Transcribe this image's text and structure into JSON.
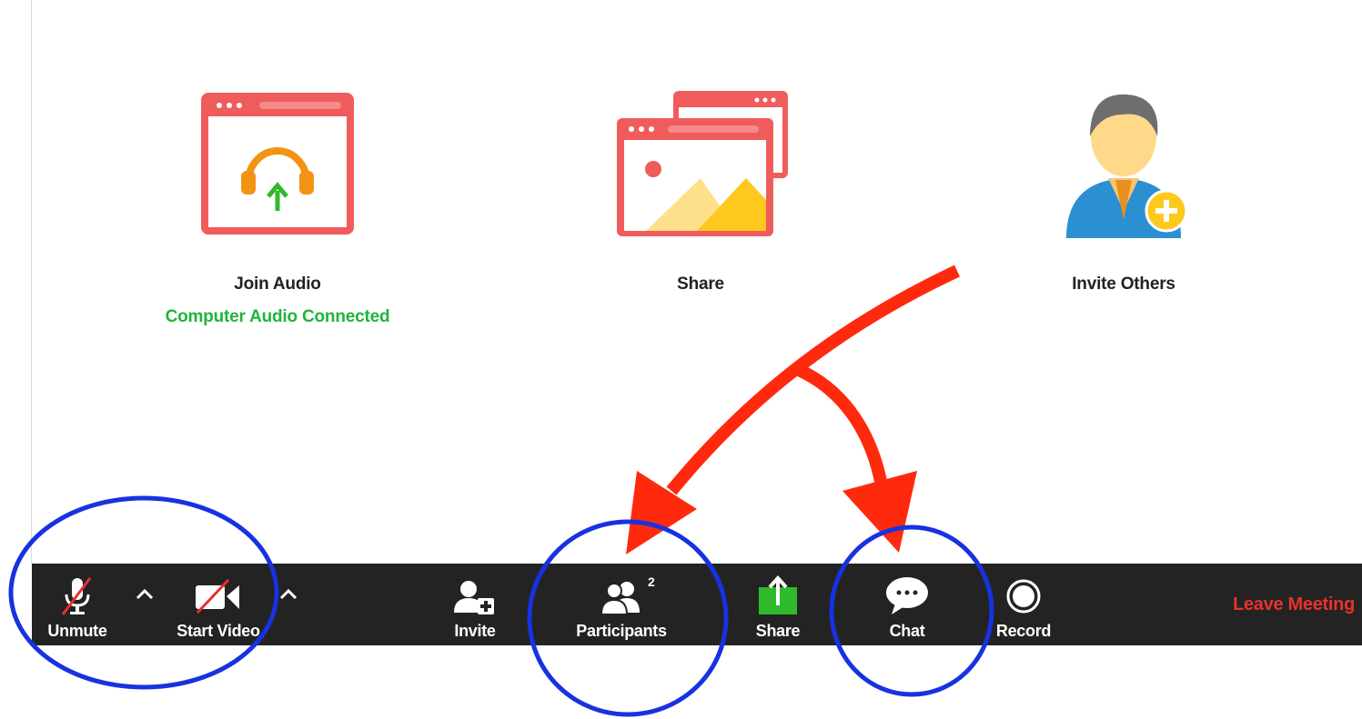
{
  "options": {
    "join_audio": {
      "label": "Join Audio",
      "status": "Computer Audio Connected"
    },
    "share": {
      "label": "Share"
    },
    "invite_others": {
      "label": "Invite Others"
    }
  },
  "toolbar": {
    "unmute": "Unmute",
    "start_video": "Start Video",
    "invite": "Invite",
    "participants": "Participants",
    "participants_count": "2",
    "share": "Share",
    "chat": "Chat",
    "record": "Record",
    "leave": "Leave Meeting"
  },
  "colors": {
    "accent_red": "#f05c5c",
    "status_green": "#1fb43b",
    "leave_red": "#e8312c",
    "annotation_blue": "#1732e0",
    "annotation_red": "#ff2a0e",
    "toolbar_bg": "#232323"
  },
  "icons": {
    "join_audio": "headphones-window-icon",
    "share": "picture-windows-icon",
    "invite_others": "person-add-icon",
    "unmute": "muted-microphone-icon",
    "start_video": "video-off-icon",
    "invite": "person-plus-icon",
    "participants": "people-icon",
    "share_toolbar": "share-upload-icon",
    "chat": "chat-bubble-icon",
    "record": "record-circle-icon"
  }
}
